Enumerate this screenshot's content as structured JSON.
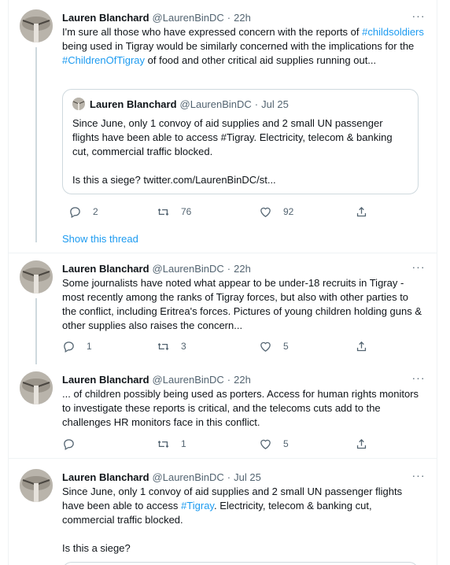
{
  "tweets": [
    {
      "name": "Lauren Blanchard",
      "handle": "@LaurenBinDC",
      "separator": "·",
      "time": "22h",
      "text_parts": [
        "I'm sure all those who have expressed concern with the reports of ",
        "#childsoldiers",
        " being used in Tigray would be similarly concerned with the implications for the ",
        "#ChildrenOfTigray",
        " of food and other critical aid supplies running out..."
      ],
      "quote": {
        "name": "Lauren Blanchard",
        "handle": "@LaurenBinDC",
        "separator": "·",
        "time": "Jul 25",
        "text": "Since June, only 1 convoy of aid supplies and 2 small UN passenger flights have been able to access #Tigray. Electricity, telecom & banking cut, commercial traffic blocked.\n\nIs this a siege? twitter.com/LaurenBinDC/st..."
      },
      "replies": "2",
      "retweets": "76",
      "likes": "92"
    },
    {
      "name": "Lauren Blanchard",
      "handle": "@LaurenBinDC",
      "separator": "·",
      "time": "22h",
      "text": "Some journalists have noted what appear to be under-18 recruits in Tigray - most recently among the ranks of Tigray forces, but also with other parties to the conflict, including Eritrea's forces. Pictures of young children holding guns & other supplies also raises the concern...",
      "replies": "1",
      "retweets": "3",
      "likes": "5"
    },
    {
      "name": "Lauren Blanchard",
      "handle": "@LaurenBinDC",
      "separator": "·",
      "time": "22h",
      "text": "... of children possibly being used as porters. Access for human rights monitors to investigate these reports is critical, and the telecoms cuts add to the challenges HR monitors face in this conflict.",
      "replies": "",
      "retweets": "1",
      "likes": "5"
    },
    {
      "name": "Lauren Blanchard",
      "handle": "@LaurenBinDC",
      "separator": "·",
      "time": "Jul 25",
      "text_parts": [
        "Since June, only 1 convoy of aid supplies and 2 small UN passenger flights have been able to access ",
        "#Tigray",
        ". Electricity, telecom & banking cut, commercial traffic blocked.\n\nIs this a siege?"
      ]
    }
  ],
  "show_thread": "Show this thread",
  "more_icon_glyph": "···",
  "colors": {
    "link": "#1d9bf0",
    "muted": "#536471",
    "border": "#eff3f4"
  }
}
